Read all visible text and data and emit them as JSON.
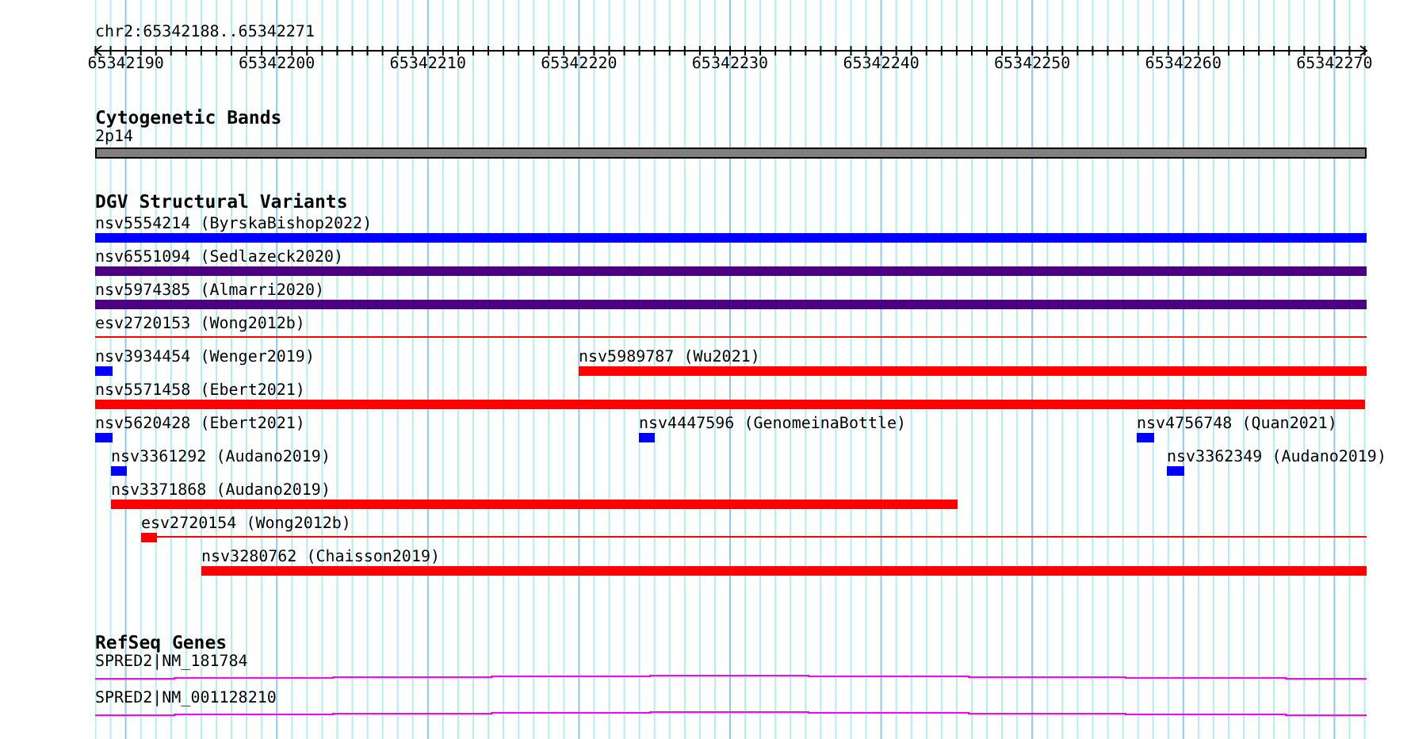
{
  "ruler": {
    "location": "chr2:65342188..65342271",
    "ticks": [
      "65342190",
      "65342200",
      "65342210",
      "65342220",
      "65342230",
      "65342240",
      "65342250",
      "65342260",
      "65342270"
    ]
  },
  "cytobands": {
    "title": "Cytogenetic Bands",
    "band": {
      "label": "2p14"
    }
  },
  "variants": {
    "title": "DGV Structural Variants",
    "features": [
      {
        "label": "nsv5554214 (ByrskaBishop2022)",
        "color": "#0000ff",
        "kind": "thick"
      },
      {
        "label": "nsv6551094 (Sedlazeck2020)",
        "color": "#4b0082",
        "kind": "thick"
      },
      {
        "label": "nsv5974385 (Almarri2020)",
        "color": "#4b0082",
        "kind": "thick"
      },
      {
        "label": "esv2720153 (Wong2012b)",
        "color": "#ff0000",
        "kind": "thin"
      },
      {
        "label": "nsv3934454 (Wenger2019)",
        "color": "#0000ff",
        "kind": "thick"
      },
      {
        "label": "nsv5989787 (Wu2021)",
        "color": "#ff0000",
        "kind": "thick"
      },
      {
        "label": "nsv5571458 (Ebert2021)",
        "color": "#ff0000",
        "kind": "thick"
      },
      {
        "label": "nsv5620428 (Ebert2021)",
        "color": "#0000ff",
        "kind": "thick"
      },
      {
        "label": "nsv4447596 (GenomeinaBottle)",
        "color": "#0000ff",
        "kind": "thick"
      },
      {
        "label": "nsv4756748 (Quan2021)",
        "color": "#0000ff",
        "kind": "thick"
      },
      {
        "label": "nsv3361292 (Audano2019)",
        "color": "#0000ff",
        "kind": "thick"
      },
      {
        "label": "nsv3362349 (Audano2019)",
        "color": "#0000ff",
        "kind": "thick"
      },
      {
        "label": "nsv3371868 (Audano2019)",
        "color": "#ff0000",
        "kind": "thick"
      },
      {
        "label": "esv2720154 (Wong2012b)",
        "color": "#ff0000",
        "kind": "mixed"
      },
      {
        "label": "nsv3280762 (Chaisson2019)",
        "color": "#ff0000",
        "kind": "thick"
      }
    ]
  },
  "genes": {
    "title": "RefSeq Genes",
    "transcripts": [
      {
        "label": "SPRED2|NM_181784"
      },
      {
        "label": "SPRED2|NM_001128210"
      }
    ]
  }
}
